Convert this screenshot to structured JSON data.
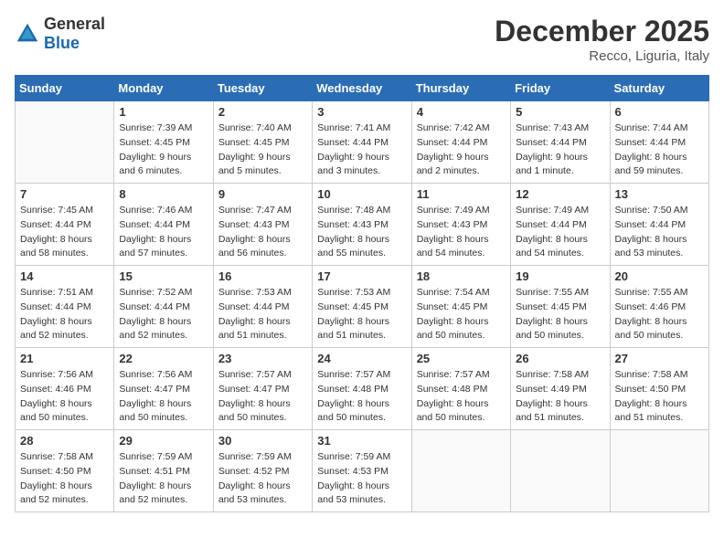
{
  "header": {
    "logo_general": "General",
    "logo_blue": "Blue",
    "month": "December 2025",
    "location": "Recco, Liguria, Italy"
  },
  "weekdays": [
    "Sunday",
    "Monday",
    "Tuesday",
    "Wednesday",
    "Thursday",
    "Friday",
    "Saturday"
  ],
  "weeks": [
    [
      {
        "day": "",
        "sunrise": "",
        "sunset": "",
        "daylight": ""
      },
      {
        "day": "1",
        "sunrise": "Sunrise: 7:39 AM",
        "sunset": "Sunset: 4:45 PM",
        "daylight": "Daylight: 9 hours and 6 minutes."
      },
      {
        "day": "2",
        "sunrise": "Sunrise: 7:40 AM",
        "sunset": "Sunset: 4:45 PM",
        "daylight": "Daylight: 9 hours and 5 minutes."
      },
      {
        "day": "3",
        "sunrise": "Sunrise: 7:41 AM",
        "sunset": "Sunset: 4:44 PM",
        "daylight": "Daylight: 9 hours and 3 minutes."
      },
      {
        "day": "4",
        "sunrise": "Sunrise: 7:42 AM",
        "sunset": "Sunset: 4:44 PM",
        "daylight": "Daylight: 9 hours and 2 minutes."
      },
      {
        "day": "5",
        "sunrise": "Sunrise: 7:43 AM",
        "sunset": "Sunset: 4:44 PM",
        "daylight": "Daylight: 9 hours and 1 minute."
      },
      {
        "day": "6",
        "sunrise": "Sunrise: 7:44 AM",
        "sunset": "Sunset: 4:44 PM",
        "daylight": "Daylight: 8 hours and 59 minutes."
      }
    ],
    [
      {
        "day": "7",
        "sunrise": "Sunrise: 7:45 AM",
        "sunset": "Sunset: 4:44 PM",
        "daylight": "Daylight: 8 hours and 58 minutes."
      },
      {
        "day": "8",
        "sunrise": "Sunrise: 7:46 AM",
        "sunset": "Sunset: 4:44 PM",
        "daylight": "Daylight: 8 hours and 57 minutes."
      },
      {
        "day": "9",
        "sunrise": "Sunrise: 7:47 AM",
        "sunset": "Sunset: 4:43 PM",
        "daylight": "Daylight: 8 hours and 56 minutes."
      },
      {
        "day": "10",
        "sunrise": "Sunrise: 7:48 AM",
        "sunset": "Sunset: 4:43 PM",
        "daylight": "Daylight: 8 hours and 55 minutes."
      },
      {
        "day": "11",
        "sunrise": "Sunrise: 7:49 AM",
        "sunset": "Sunset: 4:43 PM",
        "daylight": "Daylight: 8 hours and 54 minutes."
      },
      {
        "day": "12",
        "sunrise": "Sunrise: 7:49 AM",
        "sunset": "Sunset: 4:44 PM",
        "daylight": "Daylight: 8 hours and 54 minutes."
      },
      {
        "day": "13",
        "sunrise": "Sunrise: 7:50 AM",
        "sunset": "Sunset: 4:44 PM",
        "daylight": "Daylight: 8 hours and 53 minutes."
      }
    ],
    [
      {
        "day": "14",
        "sunrise": "Sunrise: 7:51 AM",
        "sunset": "Sunset: 4:44 PM",
        "daylight": "Daylight: 8 hours and 52 minutes."
      },
      {
        "day": "15",
        "sunrise": "Sunrise: 7:52 AM",
        "sunset": "Sunset: 4:44 PM",
        "daylight": "Daylight: 8 hours and 52 minutes."
      },
      {
        "day": "16",
        "sunrise": "Sunrise: 7:53 AM",
        "sunset": "Sunset: 4:44 PM",
        "daylight": "Daylight: 8 hours and 51 minutes."
      },
      {
        "day": "17",
        "sunrise": "Sunrise: 7:53 AM",
        "sunset": "Sunset: 4:45 PM",
        "daylight": "Daylight: 8 hours and 51 minutes."
      },
      {
        "day": "18",
        "sunrise": "Sunrise: 7:54 AM",
        "sunset": "Sunset: 4:45 PM",
        "daylight": "Daylight: 8 hours and 50 minutes."
      },
      {
        "day": "19",
        "sunrise": "Sunrise: 7:55 AM",
        "sunset": "Sunset: 4:45 PM",
        "daylight": "Daylight: 8 hours and 50 minutes."
      },
      {
        "day": "20",
        "sunrise": "Sunrise: 7:55 AM",
        "sunset": "Sunset: 4:46 PM",
        "daylight": "Daylight: 8 hours and 50 minutes."
      }
    ],
    [
      {
        "day": "21",
        "sunrise": "Sunrise: 7:56 AM",
        "sunset": "Sunset: 4:46 PM",
        "daylight": "Daylight: 8 hours and 50 minutes."
      },
      {
        "day": "22",
        "sunrise": "Sunrise: 7:56 AM",
        "sunset": "Sunset: 4:47 PM",
        "daylight": "Daylight: 8 hours and 50 minutes."
      },
      {
        "day": "23",
        "sunrise": "Sunrise: 7:57 AM",
        "sunset": "Sunset: 4:47 PM",
        "daylight": "Daylight: 8 hours and 50 minutes."
      },
      {
        "day": "24",
        "sunrise": "Sunrise: 7:57 AM",
        "sunset": "Sunset: 4:48 PM",
        "daylight": "Daylight: 8 hours and 50 minutes."
      },
      {
        "day": "25",
        "sunrise": "Sunrise: 7:57 AM",
        "sunset": "Sunset: 4:48 PM",
        "daylight": "Daylight: 8 hours and 50 minutes."
      },
      {
        "day": "26",
        "sunrise": "Sunrise: 7:58 AM",
        "sunset": "Sunset: 4:49 PM",
        "daylight": "Daylight: 8 hours and 51 minutes."
      },
      {
        "day": "27",
        "sunrise": "Sunrise: 7:58 AM",
        "sunset": "Sunset: 4:50 PM",
        "daylight": "Daylight: 8 hours and 51 minutes."
      }
    ],
    [
      {
        "day": "28",
        "sunrise": "Sunrise: 7:58 AM",
        "sunset": "Sunset: 4:50 PM",
        "daylight": "Daylight: 8 hours and 52 minutes."
      },
      {
        "day": "29",
        "sunrise": "Sunrise: 7:59 AM",
        "sunset": "Sunset: 4:51 PM",
        "daylight": "Daylight: 8 hours and 52 minutes."
      },
      {
        "day": "30",
        "sunrise": "Sunrise: 7:59 AM",
        "sunset": "Sunset: 4:52 PM",
        "daylight": "Daylight: 8 hours and 53 minutes."
      },
      {
        "day": "31",
        "sunrise": "Sunrise: 7:59 AM",
        "sunset": "Sunset: 4:53 PM",
        "daylight": "Daylight: 8 hours and 53 minutes."
      },
      {
        "day": "",
        "sunrise": "",
        "sunset": "",
        "daylight": ""
      },
      {
        "day": "",
        "sunrise": "",
        "sunset": "",
        "daylight": ""
      },
      {
        "day": "",
        "sunrise": "",
        "sunset": "",
        "daylight": ""
      }
    ]
  ]
}
